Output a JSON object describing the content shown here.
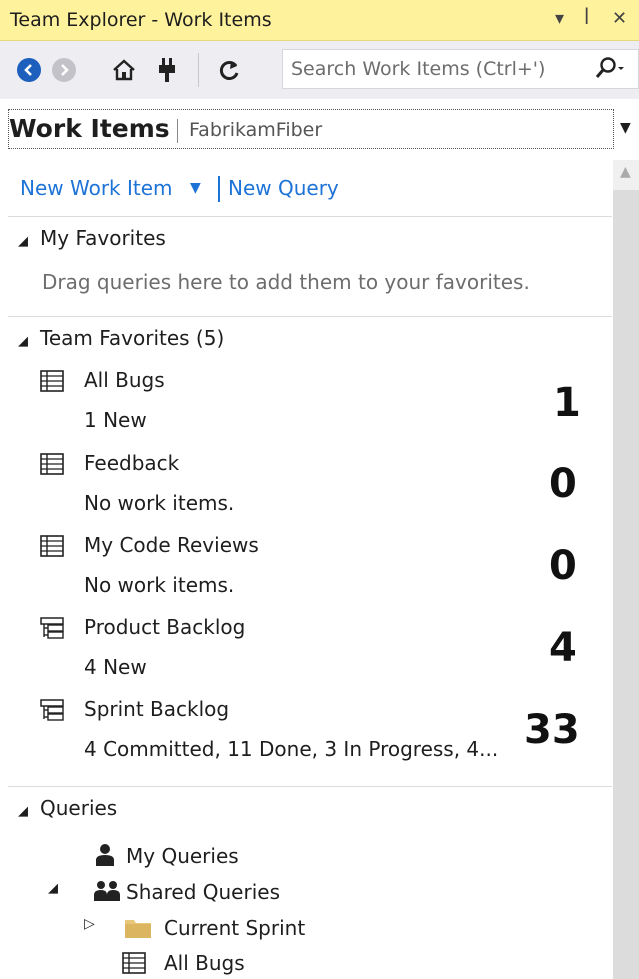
{
  "window": {
    "title": "Team Explorer - Work Items",
    "controls": [
      "▾",
      "ꟾ",
      "✕"
    ]
  },
  "toolbar": {
    "back_icon": "back-arrow-icon",
    "forward_icon": "forward-arrow-icon",
    "home_icon": "home-icon",
    "connect_icon": "plug-icon",
    "refresh_icon": "refresh-icon",
    "search_placeholder": "Search Work Items (Ctrl+')",
    "search_icon": "magnifier-icon"
  },
  "header": {
    "page": "Work Items",
    "project": "FabrikamFiber"
  },
  "actions": {
    "new_work_item": "New Work Item",
    "new_query": "New Query"
  },
  "my_favorites": {
    "title": "My Favorites",
    "hint": "Drag queries here to add them to your favorites."
  },
  "team_favorites": {
    "title": "Team Favorites (5)",
    "items": [
      {
        "name": "All Bugs",
        "sub": "1 New",
        "count": "1",
        "icon": "flat-list-icon"
      },
      {
        "name": "Feedback",
        "sub": "No work items.",
        "count": "0",
        "icon": "flat-list-icon"
      },
      {
        "name": "My Code Reviews",
        "sub": "No work items.",
        "count": "0",
        "icon": "flat-list-icon"
      },
      {
        "name": "Product Backlog",
        "sub": "4 New",
        "count": "4",
        "icon": "tree-list-icon"
      },
      {
        "name": "Sprint Backlog",
        "sub": "4 Committed, 11 Done, 3 In Progress, 4...",
        "count": "33",
        "icon": "tree-list-icon"
      }
    ]
  },
  "queries": {
    "title": "Queries",
    "tree": [
      {
        "label": "My Queries",
        "icon": "user-icon"
      },
      {
        "label": "Shared Queries",
        "icon": "group-icon"
      },
      {
        "label": "Current Sprint",
        "icon": "folder-icon"
      },
      {
        "label": "All Bugs",
        "icon": "flat-list-icon"
      }
    ]
  },
  "colors": {
    "titlebar": "#fff29d",
    "toolbar": "#eeeef2",
    "link": "#1e73d6",
    "back_button": "#1c5fbd"
  }
}
